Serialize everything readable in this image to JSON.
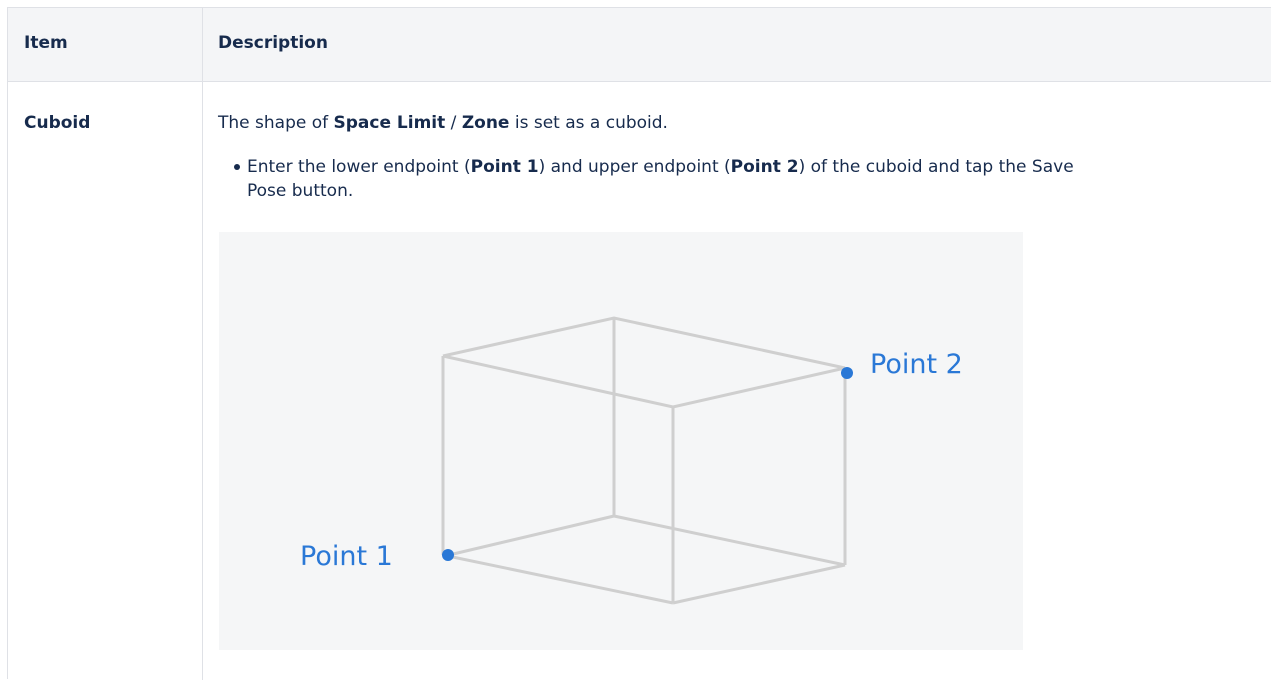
{
  "table": {
    "headers": {
      "item": "Item",
      "description": "Description"
    },
    "rows": [
      {
        "item": "Cuboid",
        "description": {
          "prefix": "The shape of ",
          "bold1": "Space Limit",
          "sep": " / ",
          "bold2": "Zone",
          "suffix": " is set as a cuboid.",
          "bullet": {
            "t1": "Enter the lower endpoint (",
            "b1": "Point 1",
            "t2": ") and upper endpoint (",
            "b2": "Point 2",
            "t3": ") of the cuboid and tap the Save Pose button."
          }
        },
        "figure": {
          "point1_label": "Point 1",
          "point2_label": "Point 2",
          "point_color": "#2a78d6",
          "edge_color": "#cfcfcf"
        }
      }
    ]
  }
}
